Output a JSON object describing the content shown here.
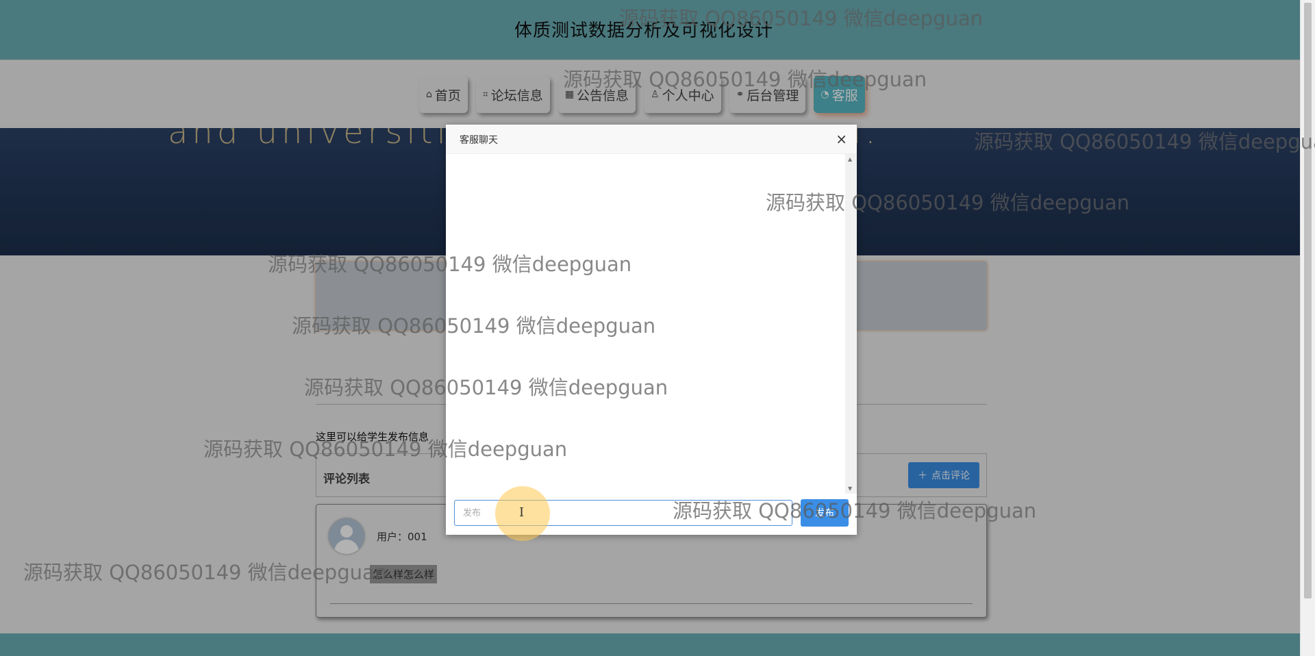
{
  "header": {
    "title": "体质测试数据分析及可视化设计"
  },
  "nav": {
    "items": [
      {
        "icon": "⌂",
        "icon_name": "home-icon",
        "label": "首页"
      },
      {
        "icon": "⌗",
        "icon_name": "tag-icon",
        "label": "论坛信息"
      },
      {
        "icon": "▦",
        "icon_name": "notice-icon",
        "label": "公告信息"
      },
      {
        "icon": "♙",
        "icon_name": "user-icon",
        "label": "个人中心"
      },
      {
        "icon": "⚭",
        "icon_name": "link-icon",
        "label": "后台管理"
      },
      {
        "icon": "◔",
        "icon_name": "service-icon",
        "label": "客服"
      }
    ],
    "active_index": 5
  },
  "banner": {
    "text": "and universities co                          ewell with you."
  },
  "page": {
    "intro_text": "这里可以给学生发布信息",
    "comments_title": "评论列表",
    "add_comment_button": "点击评论",
    "comment": {
      "user": "用户：001",
      "content": "怎么样怎么样"
    }
  },
  "modal": {
    "title": "客服聊天",
    "close_icon": "×",
    "input_placeholder": "发布",
    "send_label": "发布"
  },
  "watermark_text": "源码获取 QQ86050149 微信deepguan",
  "colors": {
    "header_bg": "#6aaeb5",
    "banner_bg": "#223657",
    "primary_button": "#3a8ee6",
    "active_nav": "#58b8c4"
  }
}
